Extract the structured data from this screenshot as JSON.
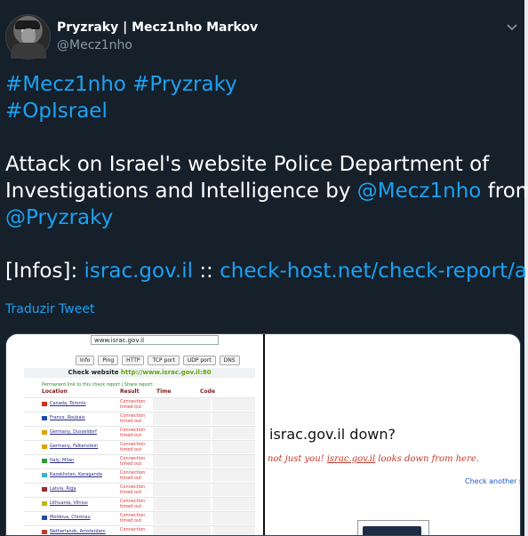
{
  "author": {
    "name": "Pryzraky | Mecz1nho Markov",
    "handle": "@Mecz1nho"
  },
  "tweet": {
    "hashtags": [
      "#Mecz1nho",
      "#Pryzraky",
      "#OpIsrael"
    ],
    "text_part1": "Attack on Israel's website Police Department of",
    "text_part2": "Investigations and Intelligence by",
    "mention1": "@Mecz1nho",
    "text_from": "from",
    "mention2": "@Pryzraky",
    "infos_label": "[Infos]:",
    "link1": "israc.gov.il",
    "separator": "::",
    "link2": "check-host.net/check-report/a…"
  },
  "translate_label": "Traduzir Tweet",
  "media": {
    "left": {
      "url_value": "www.israc.gov.il",
      "buttons": [
        "Info",
        "Ping",
        "HTTP",
        "TCP port",
        "UDP port",
        "DNS"
      ],
      "check_prefix": "Check website",
      "check_url": "http://www.israc.gov.il:80",
      "permalink_text": "Permanent link to this check report | Share report:",
      "columns": [
        "Location",
        "Result",
        "Time",
        "Code"
      ],
      "rows": [
        {
          "location": "Canada, Toronto",
          "result": "Connection timed out",
          "flag": "#d52b1e"
        },
        {
          "location": "France, Roubaix",
          "result": "Connection timed out",
          "flag": "#1f4ea8"
        },
        {
          "location": "Germany, Dusseldorf",
          "result": "Connection timed out",
          "flag": "#e0a000"
        },
        {
          "location": "Germany, Falkenstein",
          "result": "Connection timed out",
          "flag": "#e0a000"
        },
        {
          "location": "Italy, Milan",
          "result": "Connection timed out",
          "flag": "#2e9b3a"
        },
        {
          "location": "Kazakhstan, Karaganda",
          "result": "Connection timed out",
          "flag": "#2fb6d6"
        },
        {
          "location": "Latvia, Riga",
          "result": "Connection timed out",
          "flag": "#9e2a2a"
        },
        {
          "location": "Lithuania, Vilnius",
          "result": "Connection timed out",
          "flag": "#c9b200"
        },
        {
          "location": "Moldova, Chisinau",
          "result": "Connection timed out",
          "flag": "#1f4ea8"
        },
        {
          "location": "Netherlands, Amsterdam",
          "result": "Connection",
          "flag": "#c0392b"
        }
      ]
    },
    "right": {
      "title": "israc.gov.il down?",
      "sub_pre": "not just you!",
      "sub_link": "israc.gov.il",
      "sub_post": "looks down from here.",
      "check_other": "Check another si"
    }
  },
  "colors": {
    "background": "#15202b",
    "accent": "#1da1f2",
    "secondary_text": "#8899a6"
  }
}
